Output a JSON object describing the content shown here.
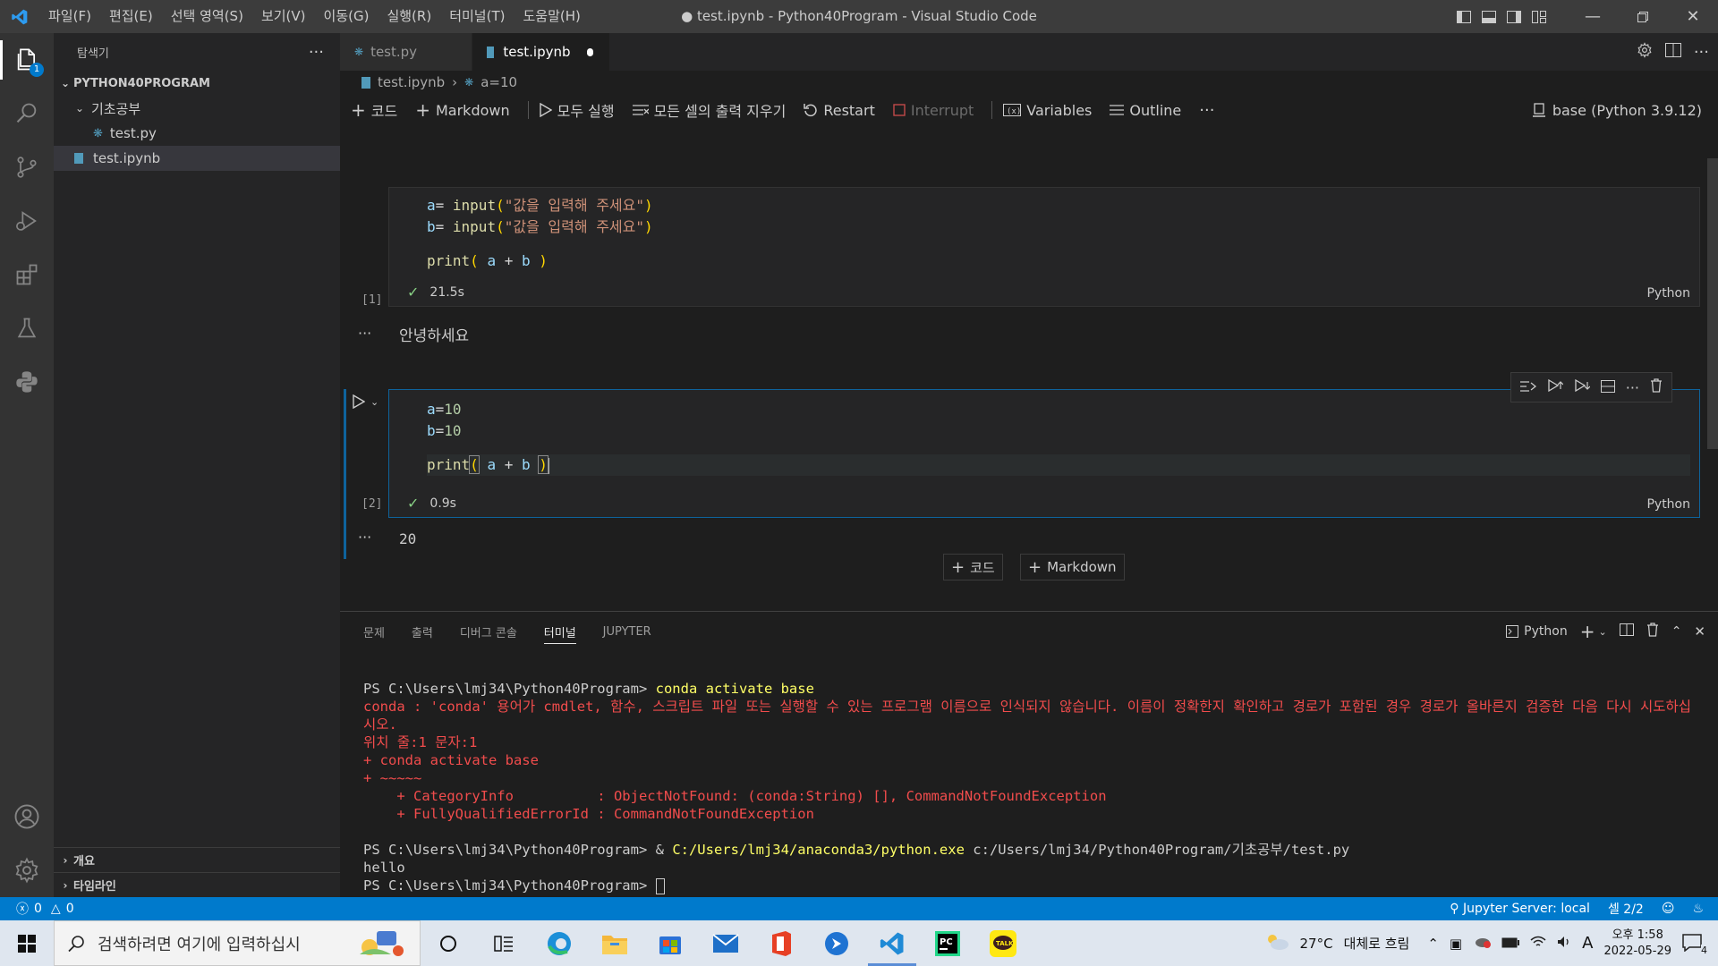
{
  "window": {
    "title": "● test.ipynb - Python40Program - Visual Studio Code",
    "menu": [
      "파일(F)",
      "편집(E)",
      "선택 영역(S)",
      "보기(V)",
      "이동(G)",
      "실행(R)",
      "터미널(T)",
      "도움말(H)"
    ]
  },
  "activity": {
    "explorer_badge": "1",
    "icons": [
      "files-icon",
      "search-icon",
      "source-control-icon",
      "run-debug-icon",
      "extensions-icon",
      "testing-icon",
      "python-icon"
    ]
  },
  "sidebar": {
    "title": "탐색기",
    "root": "PYTHON40PROGRAM",
    "folder": "기초공부",
    "file_in_folder": "test.py",
    "root_file": "test.ipynb",
    "outline": "개요",
    "timeline": "타임라인"
  },
  "tabs": [
    {
      "label": "test.py",
      "active": false
    },
    {
      "label": "test.ipynb",
      "active": true,
      "dirty": true
    }
  ],
  "breadcrumb": {
    "file": "test.ipynb",
    "symbol": "a=10"
  },
  "toolbar": {
    "add_code": "코드",
    "add_markdown": "Markdown",
    "run_all": "모두 실행",
    "clear_outputs": "모든 셀의 출력 지우기",
    "restart": "Restart",
    "interrupt": "Interrupt",
    "variables": "Variables",
    "outline": "Outline",
    "kernel": "base (Python 3.9.12)"
  },
  "cells": [
    {
      "exec": "[1]",
      "lines": [
        "a= input(\"값을 입력해 주세요\")",
        "b= input(\"값을 입력해 주세요\")",
        "",
        "print( a + b )"
      ],
      "status_time": "21.5s",
      "lang": "Python",
      "output": "안녕하세요"
    },
    {
      "exec": "[2]",
      "lines": [
        "a=10",
        "b=10",
        "",
        "print( a + b )"
      ],
      "status_time": "0.9s",
      "lang": "Python",
      "output": "20"
    }
  ],
  "add_cell": {
    "code": "코드",
    "markdown": "Markdown"
  },
  "panel": {
    "tabs": [
      "문제",
      "출력",
      "디버그 콘솔",
      "터미널",
      "JUPYTER"
    ],
    "active_tab": "터미널",
    "shell": "Python",
    "terminal": {
      "prompt": "PS C:\\Users\\lmj34\\Python40Program>",
      "cmd1": "conda activate base",
      "err1": "conda : 'conda' 용어가 cmdlet, 함수, 스크립트 파일 또는 실행할 수 있는 프로그램 이름으로 인식되지 않습니다. 이름이 정확한지 확인하고 경로가 포함된 경우 경로가 올바른지 검증한 다음 다시 시도하십시오.",
      "err2": "위치 줄:1 문자:1",
      "err3": "+ conda activate base",
      "err4": "+ ~~~~~",
      "err5": "    + CategoryInfo          : ObjectNotFound: (conda:String) [], CommandNotFoundException",
      "err6": "    + FullyQualifiedErrorId : CommandNotFoundException",
      "cmd2_amp": "&",
      "cmd2_exe": "C:/Users/lmj34/anaconda3/python.exe",
      "cmd2_arg": "c:/Users/lmj34/Python40Program/기초공부/test.py",
      "out": "hello"
    }
  },
  "statusbar": {
    "errors": "0",
    "warnings": "0",
    "jupyter": "Jupyter Server: local",
    "cell": "셀 2/2"
  },
  "taskbar": {
    "search_placeholder": "검색하려면 여기에 입력하십시",
    "weather_temp": "27°C",
    "weather_desc": "대체로 흐림",
    "ime": "A",
    "time": "오후 1:58",
    "date": "2022-05-29",
    "notifications": "4"
  }
}
